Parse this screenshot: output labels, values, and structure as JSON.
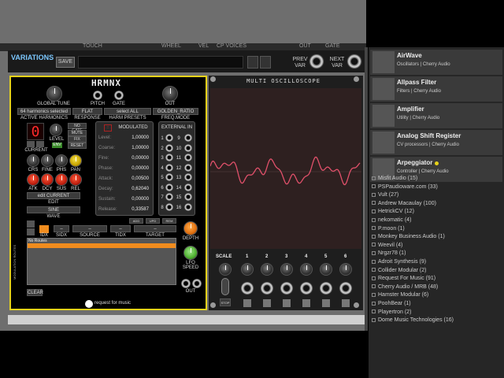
{
  "topstrip": [
    "TOUCH",
    "WHEEL",
    "VEL",
    "CP VOICES",
    "OUT",
    "GATE"
  ],
  "variations": {
    "title": "VARIATIONS",
    "save_label": "SAVE",
    "prev_label": "PREV\nVAR",
    "next_label": "NEXT\nVAR"
  },
  "hrmnx": {
    "title": "HRMNX",
    "global_tune": "GLOBAL TUNE",
    "pitch": "PITCH",
    "gate": "GATE",
    "out": "OUT",
    "harmonics_selected": "64 harmonics selected",
    "flat": "FLAT",
    "select_all": "select ALL",
    "golden_ratio": "GOLDEN_RATIO",
    "active_harmonics": "ACTIVE HARMONICS",
    "response": "RESPONSE",
    "harm_presets": "HARM PRESETS",
    "freq_mode": "FREQ.MODE",
    "current_value": "0",
    "level": "LEVEL",
    "env": "ENV",
    "no_gate": "NO GATE",
    "mute": "MUTE",
    "fix": "FIX",
    "reset": "RESET",
    "current": "CURRENT",
    "knob_labels_1": [
      "CRS",
      "FINE",
      "PHS",
      "PAN"
    ],
    "knob_labels_2": [
      "ATK",
      "DCY",
      "SUS",
      "REL"
    ],
    "edit_current": "edit CURRENT",
    "edit": "EDIT",
    "sine": "SINE",
    "wave": "WAVE",
    "modulated_title": "MODULATED",
    "modulated": [
      {
        "name": "Level:",
        "value": "1,00000"
      },
      {
        "name": "Coarse:",
        "value": "1,00000"
      },
      {
        "name": "Fine:",
        "value": "0,00000"
      },
      {
        "name": "Phase:",
        "value": "0,00000"
      },
      {
        "name": "Attack:",
        "value": "0,00500"
      },
      {
        "name": "Decay:",
        "value": "0,62040"
      },
      {
        "name": "Sustain:",
        "value": "0,00000"
      },
      {
        "name": "Release:",
        "value": "0,33587"
      }
    ],
    "external_in": "EXTERNAL IN",
    "ext_left": [
      "1",
      "2",
      "3",
      "4",
      "5",
      "6",
      "7",
      "8"
    ],
    "ext_right": [
      "9",
      "10",
      "11",
      "12",
      "13",
      "14",
      "15",
      "16"
    ],
    "add": "ADD",
    "upd": "UPD",
    "rem": "REM",
    "route_headers": [
      "IDX",
      "SIDX",
      "SOURCE",
      "TIDX",
      "TARGET"
    ],
    "no_routes": "No Routes",
    "modulation_routes": "MODULATION ROUTES",
    "clear": "CLEAR",
    "depth": "DEPTH",
    "lfo_speed": "LFO\nSPEED",
    "out2": "OUT",
    "brand": "request for music"
  },
  "scope": {
    "title": "MULTI OSCILLOSCOPE",
    "scale": "SCALE",
    "channels": [
      "1",
      "2",
      "3",
      "4",
      "5",
      "6"
    ],
    "stop": "STOP"
  },
  "sidebar": {
    "plugins": [
      {
        "name": "AirWave",
        "meta": "Oscillators | Cherry Audio"
      },
      {
        "name": "Allpass Filter",
        "meta": "Filters | Cherry Audio"
      },
      {
        "name": "Amplifier",
        "meta": "Utility | Cherry Audio"
      },
      {
        "name": "Analog Shift Register",
        "meta": "CV processors | Cherry Audio"
      },
      {
        "name": "Arpeggiator",
        "meta": "Controller | Cherry Audio"
      }
    ],
    "brands": [
      "Misfit Audio (15)",
      "PSPaudioware.com (33)",
      "Vult (27)",
      "Andrew Macaulay (100)",
      "HetrickCV (12)",
      "nekomatic (4)",
      "P.moon (1)",
      "Monkey Business Audio (1)",
      "Weevil (4)",
      "Nrgzr78 (1)",
      "Adroit Synthesis (9)",
      "Collider Modular (2)",
      "Request For Music (91)",
      "Cherry Audio / MRB (48)",
      "Hamster Modular (6)",
      "PoohBear (1)",
      "Playertron (2)",
      "Dome Music Technologies (16)"
    ]
  },
  "colors": {
    "accent_yellow": "#e6d21a",
    "orange": "#f08c1e",
    "scope_trace": "#e0506a",
    "var_title": "#7cc8ff"
  }
}
